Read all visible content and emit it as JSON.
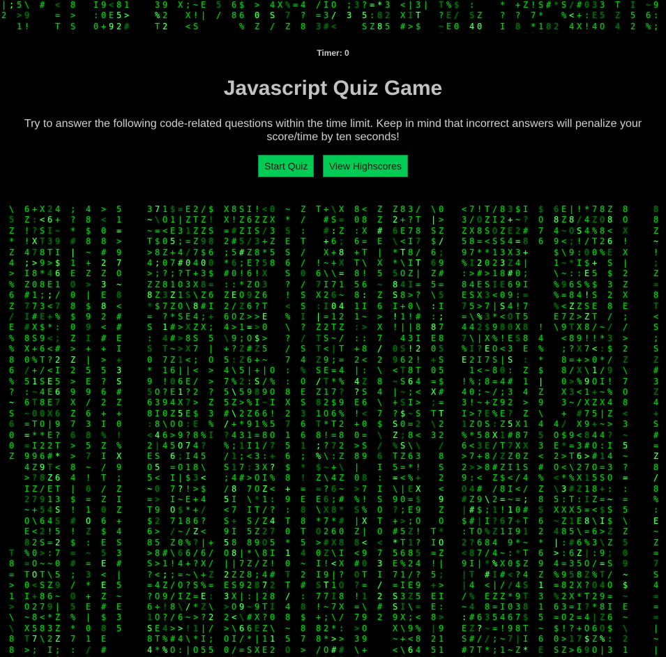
{
  "timer": {
    "label": "Timer: 0"
  },
  "title": "Javascript Quiz Game",
  "description": "Try to answer the following code-related questions within the time limit. Keep in mind that incorrect answers will penalize your score/time by ten seconds!",
  "buttons": {
    "start_label": "Start Quiz",
    "highscores_label": "View Highscores"
  },
  "colors": {
    "background": "#000000",
    "matrix_green": "#12c41e",
    "button_green": "#00cc55",
    "text_gray": "#c2c2c2"
  },
  "icons": {
    "background": "matrix-code-rain"
  }
}
